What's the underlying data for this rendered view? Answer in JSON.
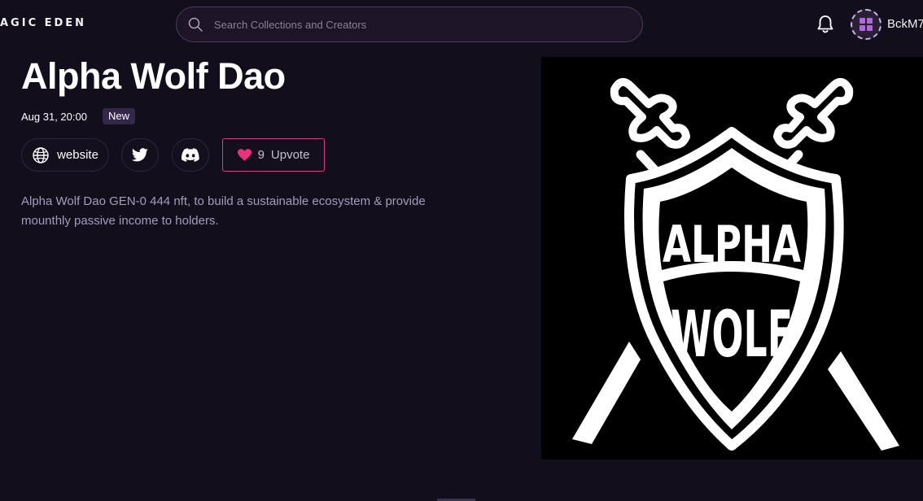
{
  "header": {
    "logo_text": "AGIC EDEN",
    "search_placeholder": "Search Collections and Creators",
    "username": "BckM7"
  },
  "icons": {
    "search": "search-icon",
    "notifications": "bell-icon",
    "website": "globe-icon",
    "twitter": "twitter-icon",
    "discord": "discord-icon",
    "upvote": "heart-icon"
  },
  "project": {
    "title": "Alpha Wolf Dao",
    "date": "Aug 31, 20:00",
    "badge": "New",
    "links": {
      "website_label": "website"
    },
    "upvote": {
      "count": "9",
      "label": "Upvote"
    },
    "description": "Alpha Wolf Dao GEN-0 444 nft, to build a sustainable ecosystem & provide mounthly passive income to holders.",
    "image_text": [
      "ALPHA",
      "WOLF"
    ]
  },
  "colors": {
    "background": "#130e1b",
    "accent_pink": "#e8327d",
    "badge_bg": "#33284a",
    "description_text": "#a79bbd"
  }
}
